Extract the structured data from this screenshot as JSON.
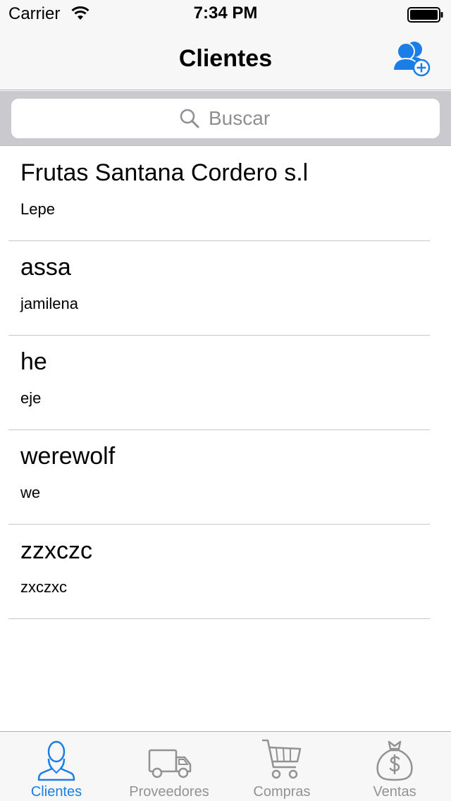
{
  "status_bar": {
    "carrier": "Carrier",
    "time": "7:34 PM"
  },
  "nav": {
    "title": "Clientes",
    "add_icon": "add-user-icon"
  },
  "search": {
    "placeholder": "Buscar"
  },
  "clients": [
    {
      "name": "Frutas Santana Cordero s.l",
      "city": "Lepe"
    },
    {
      "name": "assa",
      "city": "jamilena"
    },
    {
      "name": "he",
      "city": "eje"
    },
    {
      "name": "werewolf",
      "city": "we"
    },
    {
      "name": "zzxczc",
      "city": "zxczxc"
    }
  ],
  "tabs": [
    {
      "label": "Clientes",
      "icon": "person-icon",
      "active": true
    },
    {
      "label": "Proveedores",
      "icon": "truck-icon",
      "active": false
    },
    {
      "label": "Compras",
      "icon": "cart-icon",
      "active": false
    },
    {
      "label": "Ventas",
      "icon": "money-bag-icon",
      "active": false
    }
  ],
  "colors": {
    "accent": "#1a7ee6",
    "inactive": "#929292",
    "bar_background": "#f7f7f7",
    "search_background": "#c9c9ce"
  }
}
